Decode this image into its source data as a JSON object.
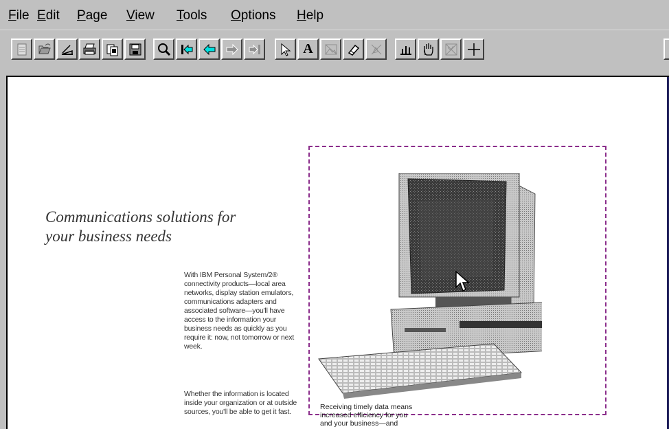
{
  "menu": {
    "items": [
      {
        "label": "File",
        "mnemonic": "F",
        "rest": "ile"
      },
      {
        "label": "Edit",
        "mnemonic": "E",
        "rest": "dit"
      },
      {
        "label": "Page",
        "mnemonic": "P",
        "rest": "age"
      },
      {
        "label": "View",
        "mnemonic": "V",
        "rest": "iew"
      },
      {
        "label": "Tools",
        "mnemonic": "T",
        "rest": "ools"
      },
      {
        "label": "Options",
        "mnemonic": "O",
        "rest": "ptions"
      },
      {
        "label": "Help",
        "mnemonic": "H",
        "rest": "elp"
      }
    ]
  },
  "toolbar": {
    "icons": [
      "new-page-icon",
      "open-icon",
      "scan-icon",
      "print-icon",
      "copy-icon",
      "save-icon",
      "zoom-icon",
      "first-page-icon",
      "previous-page-icon",
      "next-page-icon",
      "last-page-icon",
      "select-arrow-icon",
      "text-icon",
      "image-icon",
      "eraser-icon",
      "crop-icon",
      "chart-icon",
      "hand-icon",
      "picture-icon",
      "crosshair-icon"
    ],
    "text_tool_label": "A"
  },
  "document": {
    "heading_line1": "Communications solutions for",
    "heading_line2": "your business needs",
    "paragraph1": "With IBM Personal System/2® connectivity products—local area networks, display station emulators, communications adapters and associated software—you'll have access to the information your business needs as quickly as you require it: now, not tomorrow or next week.",
    "paragraph2": "Whether the information is located inside your organization or at outside sources, you'll be able to get it fast.",
    "caption_line1": "Receiving timely data means",
    "caption_line2": "increased efficiency for you",
    "caption_line3": "and your business—and"
  }
}
